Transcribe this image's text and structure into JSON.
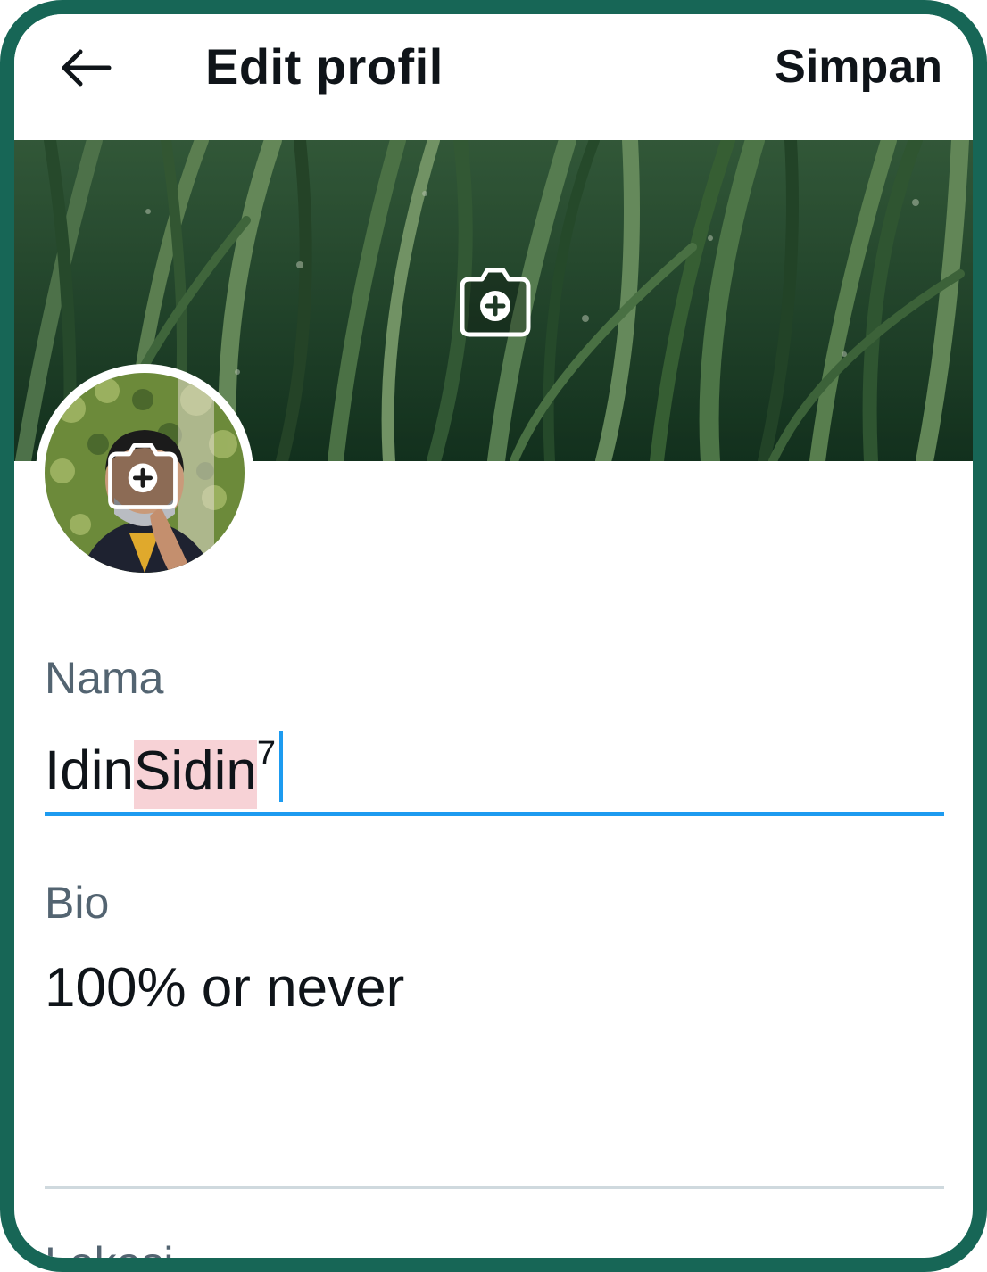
{
  "header": {
    "title": "Edit profil",
    "save_label": "Simpan",
    "back_icon": "arrow-left-icon"
  },
  "banner": {
    "camera_icon": "camera-plus-icon"
  },
  "avatar": {
    "camera_icon": "camera-plus-icon"
  },
  "fields": {
    "name": {
      "label": "Nama",
      "value_prefix": "Idin",
      "value_selected": "Sidin",
      "value_suffix": "7"
    },
    "bio": {
      "label": "Bio",
      "value": "100% or never"
    },
    "next_label": "Lokasi"
  },
  "colors": {
    "frame": "#176656",
    "accent": "#1d9bf0",
    "text": "#0f1419",
    "muted": "#536471",
    "selection": "#f7d2d6"
  }
}
